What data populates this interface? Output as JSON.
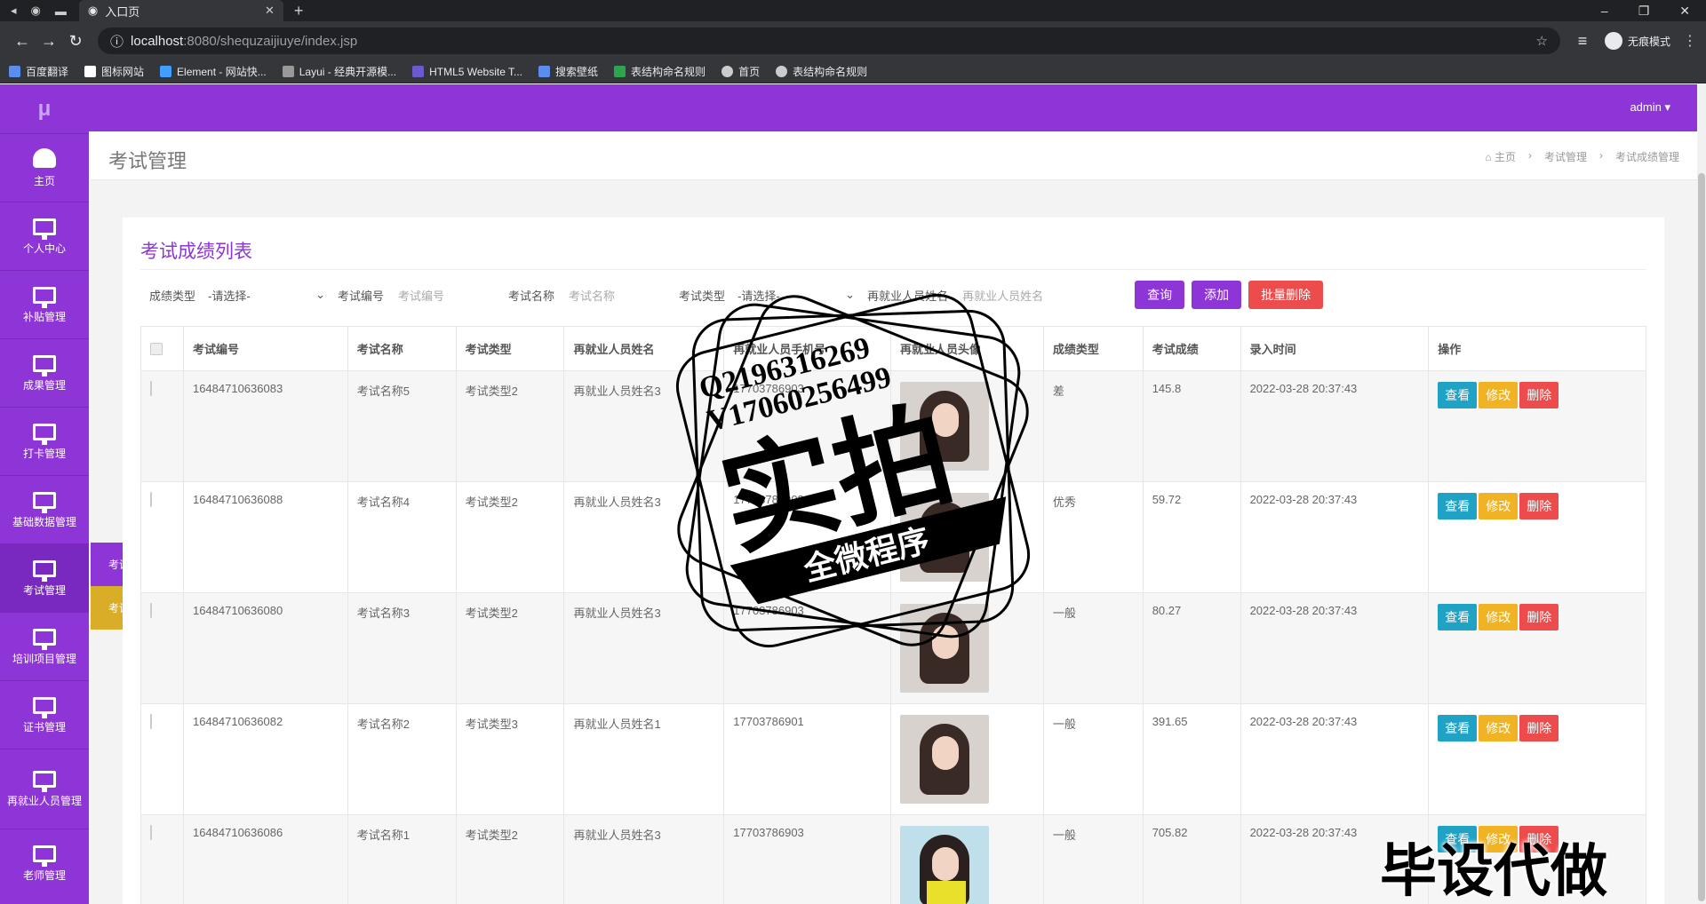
{
  "browser": {
    "tab_title": "入口页",
    "url_host": "localhost",
    "url_path": ":8080/shequzaijiuye/index.jsp",
    "incognito_label": "无痕模式",
    "bookmarks": [
      "百度翻译",
      "图标网站",
      "Element - 网站快...",
      "Layui - 经典开源模...",
      "HTML5 Website T...",
      "搜索壁纸",
      "表结构命名规则",
      "首页",
      "表结构命名规则"
    ]
  },
  "header": {
    "user": "admin ▾"
  },
  "sidebar": {
    "logo": "μ",
    "items": [
      {
        "label": "主页",
        "icon": "dashboard-icon"
      },
      {
        "label": "个人中心",
        "icon": "monitor-icon"
      },
      {
        "label": "补贴管理",
        "icon": "monitor-icon"
      },
      {
        "label": "成果管理",
        "icon": "monitor-icon"
      },
      {
        "label": "打卡管理",
        "icon": "monitor-icon"
      },
      {
        "label": "基础数据管理",
        "icon": "monitor-icon"
      },
      {
        "label": "考试管理",
        "icon": "monitor-icon"
      },
      {
        "label": "培训项目管理",
        "icon": "monitor-icon"
      },
      {
        "label": "证书管理",
        "icon": "monitor-icon"
      },
      {
        "label": "再就业人员管理",
        "icon": "monitor-icon"
      },
      {
        "label": "老师管理",
        "icon": "monitor-icon"
      }
    ],
    "flyout": [
      "考试管理",
      "考试成..."
    ]
  },
  "page": {
    "title": "考试管理",
    "breadcrumbs": [
      "主页",
      "考试管理",
      "考试成绩管理"
    ]
  },
  "panel": {
    "title": "考试成绩列表",
    "filters": {
      "score_type_label": "成绩类型",
      "score_type_value": "-请选择-",
      "exam_no_label": "考试编号",
      "exam_no_placeholder": "考试编号",
      "exam_name_label": "考试名称",
      "exam_name_placeholder": "考试名称",
      "exam_type_label": "考试类型",
      "exam_type_value": "-请选择-",
      "person_name_label": "再就业人员姓名",
      "person_name_placeholder": "再就业人员姓名"
    },
    "buttons": {
      "query": "查询",
      "add": "添加",
      "batch_delete": "批量删除"
    },
    "columns": [
      "考试编号",
      "考试名称",
      "考试类型",
      "再就业人员姓名",
      "再就业人员手机号",
      "再就业人员头像",
      "成绩类型",
      "考试成绩",
      "录入时间",
      "操作"
    ],
    "rows": [
      {
        "no": "16484710636083",
        "name": "考试名称5",
        "type": "考试类型2",
        "person": "再就业人员姓名3",
        "phone": "17703786903",
        "grade": "差",
        "score": "145.8",
        "time": "2022-03-28 20:37:43"
      },
      {
        "no": "16484710636088",
        "name": "考试名称4",
        "type": "考试类型2",
        "person": "再就业人员姓名3",
        "phone": "17703786903",
        "grade": "优秀",
        "score": "59.72",
        "time": "2022-03-28 20:37:43"
      },
      {
        "no": "16484710636080",
        "name": "考试名称3",
        "type": "考试类型2",
        "person": "再就业人员姓名3",
        "phone": "17703786903",
        "grade": "一般",
        "score": "80.27",
        "time": "2022-03-28 20:37:43"
      },
      {
        "no": "16484710636082",
        "name": "考试名称2",
        "type": "考试类型3",
        "person": "再就业人员姓名1",
        "phone": "17703786901",
        "grade": "一般",
        "score": "391.65",
        "time": "2022-03-28 20:37:43"
      },
      {
        "no": "16484710636086",
        "name": "考试名称1",
        "type": "考试类型2",
        "person": "再就业人员姓名3",
        "phone": "17703786903",
        "grade": "一般",
        "score": "705.82",
        "time": "2022-03-28 20:37:43"
      }
    ],
    "ops": {
      "view": "查看",
      "edit": "修改",
      "delete": "删除"
    }
  },
  "overlay": {
    "qq": "Q2196316269",
    "vx": "V17060256499",
    "stamp_big": "实拍",
    "stamp_banner": "全微程序",
    "watermark": "毕设代做"
  }
}
